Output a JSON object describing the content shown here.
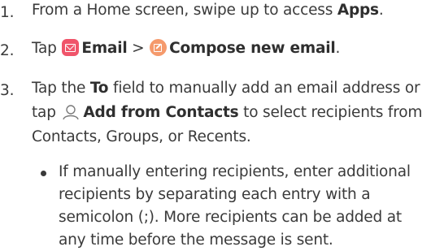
{
  "steps": [
    {
      "number": "1.",
      "text_pre": "From a Home screen, swipe up to access ",
      "bold": "Apps",
      "text_post": "."
    },
    {
      "number": "2.",
      "text_pre": "Tap ",
      "email_icon": "email-app-icon",
      "email_label": "Email",
      "separator": " > ",
      "compose_icon": "compose-icon",
      "compose_label": "Compose new email",
      "text_post": "."
    },
    {
      "number": "3.",
      "line1_pre": "Tap the ",
      "line1_bold": "To",
      "line1_post": " field to manually add an email address or",
      "line2_pre": "tap ",
      "contacts_icon": "person-outline-icon",
      "line2_bold": "Add from Contacts",
      "line2_post": " to select recipients from",
      "line3": "Contacts, Groups, or Recents."
    }
  ],
  "bullet": {
    "lines": [
      "If manually entering recipients, enter additional",
      "recipients by separating each entry with a",
      "semicolon (;). More recipients can be added at",
      "any time before the message is sent."
    ]
  }
}
